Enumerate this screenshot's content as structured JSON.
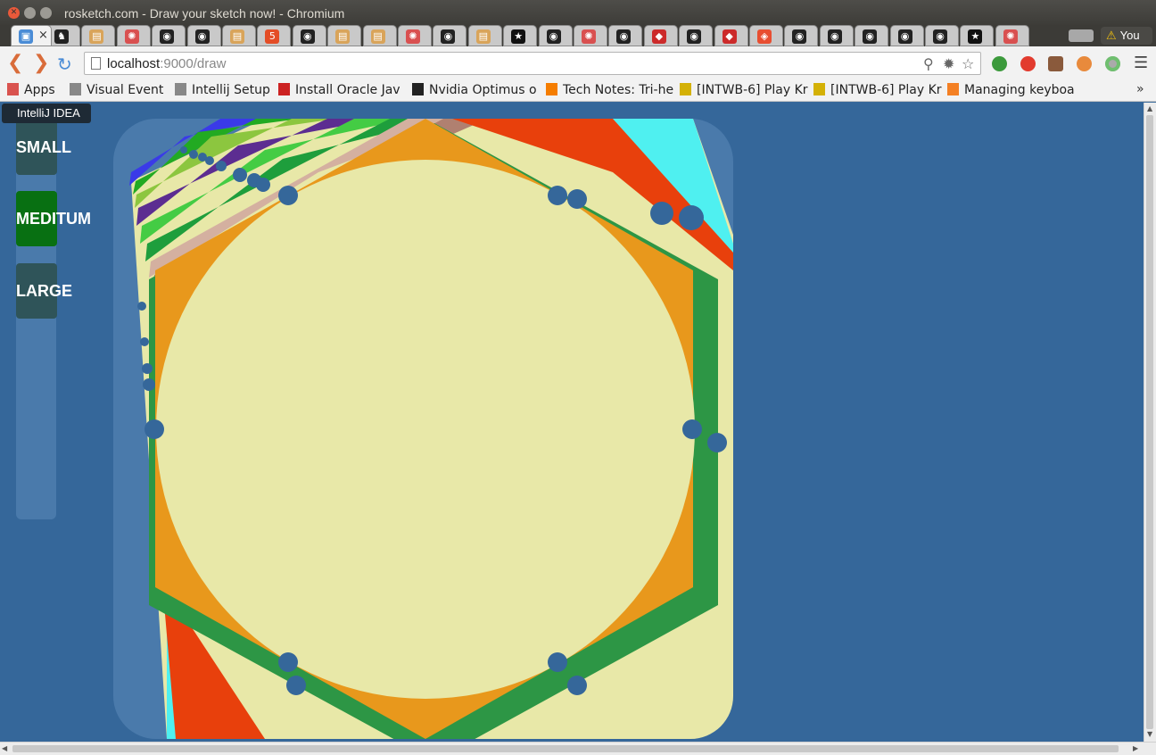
{
  "window": {
    "title": "rosketch.com - Draw your sketch now! - Chromium"
  },
  "tabs": [
    {
      "icon": "page-icon",
      "color": "#4a8cd6"
    },
    {
      "icon": "horse-icon",
      "color": "#222222"
    },
    {
      "icon": "doc-icon",
      "color": "#d9a45a"
    },
    {
      "icon": "pinwheel-icon",
      "color": "#d95050"
    },
    {
      "icon": "github-icon",
      "color": "#222222"
    },
    {
      "icon": "github-icon",
      "color": "#222222"
    },
    {
      "icon": "doc-icon",
      "color": "#d9a45a"
    },
    {
      "icon": "html5-icon",
      "color": "#e44d26"
    },
    {
      "icon": "github-icon",
      "color": "#222222"
    },
    {
      "icon": "doc-icon",
      "color": "#d9a45a"
    },
    {
      "icon": "doc-icon",
      "color": "#d9a45a"
    },
    {
      "icon": "pinwheel-icon",
      "color": "#d95050"
    },
    {
      "icon": "github-icon",
      "color": "#222222"
    },
    {
      "icon": "doc-icon",
      "color": "#d9a45a"
    },
    {
      "icon": "star-icon",
      "color": "#111111"
    },
    {
      "icon": "github-icon",
      "color": "#222222"
    },
    {
      "icon": "pinwheel-icon",
      "color": "#d95050"
    },
    {
      "icon": "github-icon",
      "color": "#222222"
    },
    {
      "icon": "shield-icon",
      "color": "#cc2a2a"
    },
    {
      "icon": "github-icon",
      "color": "#222222"
    },
    {
      "icon": "shield-icon",
      "color": "#cc2a2a"
    },
    {
      "icon": "git-icon",
      "color": "#e84e31"
    },
    {
      "icon": "github-icon",
      "color": "#222222"
    },
    {
      "icon": "github-icon",
      "color": "#222222"
    },
    {
      "icon": "github-icon",
      "color": "#222222"
    },
    {
      "icon": "github-icon",
      "color": "#222222"
    },
    {
      "icon": "github-icon",
      "color": "#222222"
    },
    {
      "icon": "star-icon",
      "color": "#111111"
    },
    {
      "icon": "pinwheel-icon",
      "color": "#d95050"
    }
  ],
  "profile": {
    "label": "You"
  },
  "toolbar": {
    "url_host": "localhost",
    "url_rest": ":9000/draw"
  },
  "bookmarks": [
    {
      "label": "Apps",
      "icon": "apps-grid-icon",
      "color": "#d9534f"
    },
    {
      "label": "Visual Event",
      "icon": "page-icon",
      "color": "#888888"
    },
    {
      "label": "Intellij Setup",
      "icon": "page-icon",
      "color": "#888888"
    },
    {
      "label": "Install Oracle Jav",
      "icon": "glasses-icon",
      "color": "#cc2222"
    },
    {
      "label": "Nvidia Optimus o",
      "icon": "tux-icon",
      "color": "#222222"
    },
    {
      "label": "Tech Notes: Tri-he",
      "icon": "blogger-icon",
      "color": "#f57d00"
    },
    {
      "label": "[INTWB-6] Play Kr",
      "icon": "jira-icon",
      "color": "#d4b106"
    },
    {
      "label": "[INTWB-6] Play Kr",
      "icon": "jira-icon",
      "color": "#d4b106"
    },
    {
      "label": "Managing keyboa",
      "icon": "stackoverflow-icon",
      "color": "#f48024"
    }
  ],
  "bookmarks_more": "»",
  "tooltip": "IntelliJ IDEA",
  "size_buttons": [
    {
      "label": "SMALL",
      "active": false
    },
    {
      "label": "MEDITUM",
      "active": true
    },
    {
      "label": "LARGE",
      "active": false
    }
  ],
  "colors": {
    "canvas_bg": "#e8e8a8",
    "orange": "#e8981c",
    "green": "#2d9645",
    "red": "#e8400c",
    "cyan": "#4ff0f0",
    "dot": "#35679a",
    "active_button": "#087012"
  }
}
